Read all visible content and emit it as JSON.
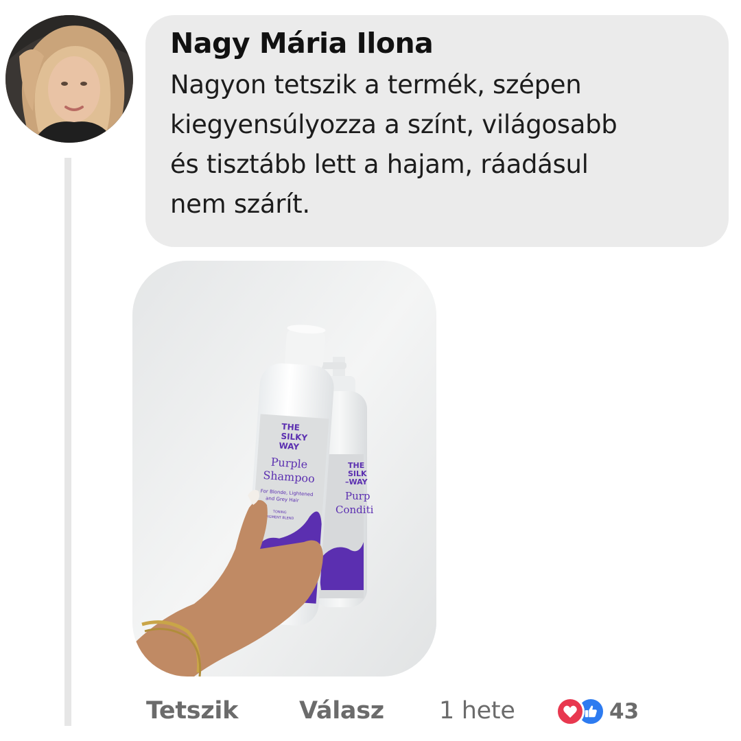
{
  "comment": {
    "author": "Nagy Mária Ilona",
    "lines": [
      "Nagyon tetszik a termék, szépen",
      "kiegyensúlyozza a színt, világosabb",
      "és tisztább lett a hajam, ráadásul",
      "nem szárít."
    ]
  },
  "photo": {
    "product_brand": [
      "THE",
      "SILKY",
      "WAY"
    ],
    "product_name": [
      "Purple",
      "Shampoo"
    ],
    "product_subtitle": [
      "For Blonde, Lightened",
      "and Grey Hair"
    ],
    "product_badge": [
      "TONING",
      "PIGMENT BLEND"
    ],
    "second_product_name": [
      "Purp",
      "Conditi"
    ]
  },
  "actions": {
    "like_label": "Tetszik",
    "reply_label": "Válasz",
    "timestamp": "1 hete"
  },
  "reactions": {
    "icons": [
      "heart-icon",
      "thumbs-up-icon"
    ],
    "count": "43",
    "colors": {
      "love": "#e8384f",
      "like": "#2d7bf0"
    }
  }
}
